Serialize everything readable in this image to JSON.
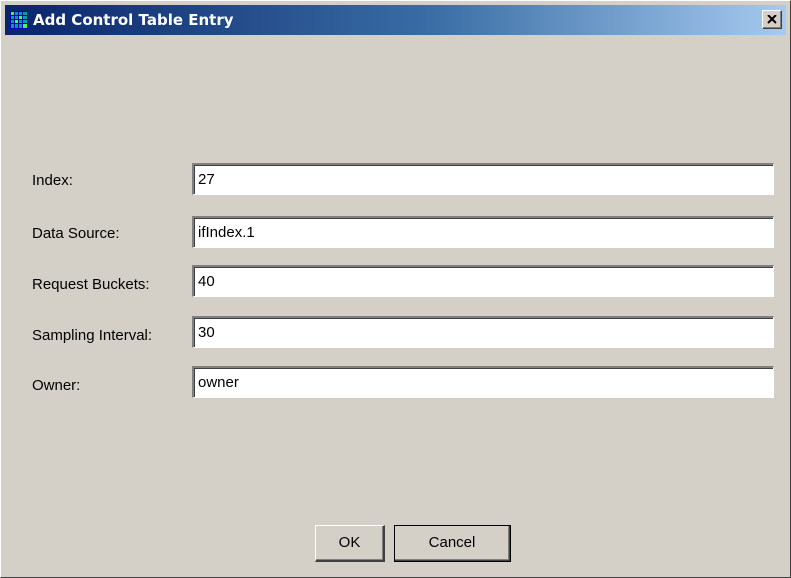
{
  "window": {
    "title": "Add Control Table Entry",
    "icon": "grid-icon",
    "close_symbol": "close-icon"
  },
  "form": {
    "fields": [
      {
        "label": "Index:",
        "value": "27"
      },
      {
        "label": "Data Source:",
        "value": "ifIndex.1"
      },
      {
        "label": "Request Buckets:",
        "value": "40"
      },
      {
        "label": "Sampling Interval:",
        "value": "30"
      },
      {
        "label": "Owner:",
        "value": "owner"
      }
    ]
  },
  "buttons": {
    "ok_label": "OK",
    "cancel_label": "Cancel"
  },
  "colors": {
    "titlebar_start": "#0a246a",
    "titlebar_end": "#a6caf0",
    "dialog_background": "#d4d0c8"
  }
}
